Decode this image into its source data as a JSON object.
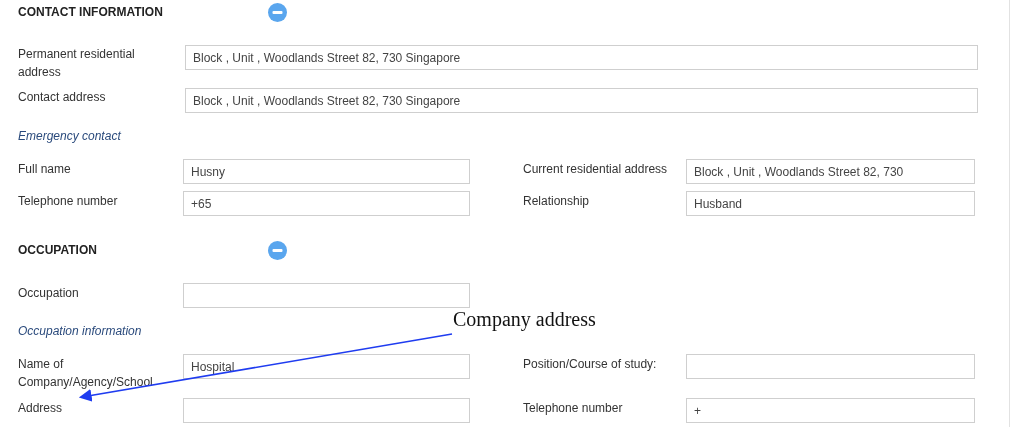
{
  "sections": [
    {
      "title": "CONTACT INFORMATION",
      "expanded": true,
      "rows": [
        {
          "kind": "wide",
          "label": "Permanent residential address",
          "value": "Block , Unit , Woodlands Street 82, 730 Singapore"
        },
        {
          "kind": "wide",
          "label": "Contact address",
          "value": "Block , Unit , Woodlands Street 82, 730 Singapore"
        },
        {
          "kind": "subheading",
          "label": "Emergency contact"
        },
        {
          "kind": "pair",
          "fields": [
            {
              "label": "Full name",
              "value": "Husny"
            },
            {
              "label": "Current residential address",
              "value": "Block , Unit , Woodlands Street 82, 730"
            }
          ]
        },
        {
          "kind": "pair",
          "fields": [
            {
              "label": "Telephone number",
              "value": "+65"
            },
            {
              "label": "Relationship",
              "value": "Husband"
            }
          ]
        }
      ]
    },
    {
      "title": "OCCUPATION",
      "expanded": true,
      "rows": [
        {
          "kind": "half",
          "label": "Occupation"
        },
        {
          "kind": "subheading",
          "label": "Occupation information"
        },
        {
          "kind": "pair",
          "fields": [
            {
              "label": "Name of Company/Agency/School",
              "value": "Hospital"
            },
            {
              "label": "Position/Course of study:"
            }
          ]
        },
        {
          "kind": "pair",
          "fields": [
            {
              "label": "Address"
            },
            {
              "label": "Telephone number",
              "value": "+"
            }
          ]
        }
      ]
    }
  ],
  "annotation": {
    "text": "Company address"
  }
}
